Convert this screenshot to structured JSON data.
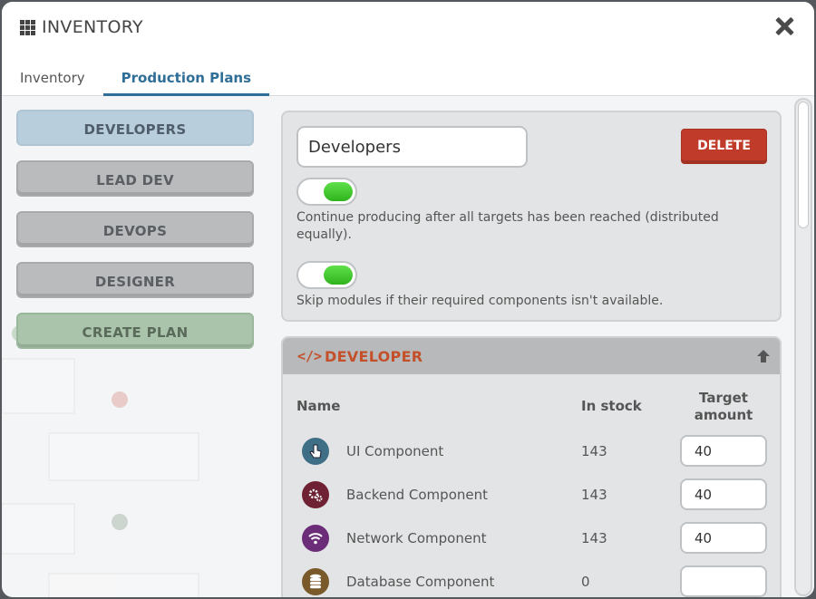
{
  "window": {
    "title": "INVENTORY"
  },
  "tabs": [
    {
      "label": "Inventory",
      "active": false
    },
    {
      "label": "Production Plans",
      "active": true
    }
  ],
  "plans": [
    {
      "label": "DEVELOPERS",
      "state": "active"
    },
    {
      "label": "LEAD DEV",
      "state": "normal"
    },
    {
      "label": "DEVOPS",
      "state": "normal"
    },
    {
      "label": "DESIGNER",
      "state": "normal"
    },
    {
      "label": "CREATE PLAN",
      "state": "create"
    }
  ],
  "plan_settings": {
    "name_value": "Developers",
    "delete_label": "DELETE",
    "toggles": [
      {
        "on": true,
        "label": "Continue producing after all targets has been reached (distributed equally)."
      },
      {
        "on": true,
        "label": "Skip modules if their required components isn't available."
      }
    ]
  },
  "module": {
    "title": "DEVELOPER",
    "icon": "code-icon",
    "columns": {
      "name": "Name",
      "stock": "In stock",
      "target_line1": "Target",
      "target_line2": "amount"
    },
    "rows": [
      {
        "name": "UI Component",
        "stock": "143",
        "target": "40",
        "icon": "pointer-hand-icon",
        "icon_color": "#3f6f86"
      },
      {
        "name": "Backend Component",
        "stock": "143",
        "target": "40",
        "icon": "gears-icon",
        "icon_color": "#6e2233"
      },
      {
        "name": "Network Component",
        "stock": "143",
        "target": "40",
        "icon": "wifi-icon",
        "icon_color": "#6b2c78"
      },
      {
        "name": "Database Component",
        "stock": "0",
        "target": "",
        "icon": "database-icon",
        "icon_color": "#7a5a2a"
      }
    ]
  },
  "colors": {
    "accent": "#2f6e97",
    "delete": "#c13b2a",
    "module_title": "#c4502a",
    "toggle_on": "#3cc228"
  }
}
